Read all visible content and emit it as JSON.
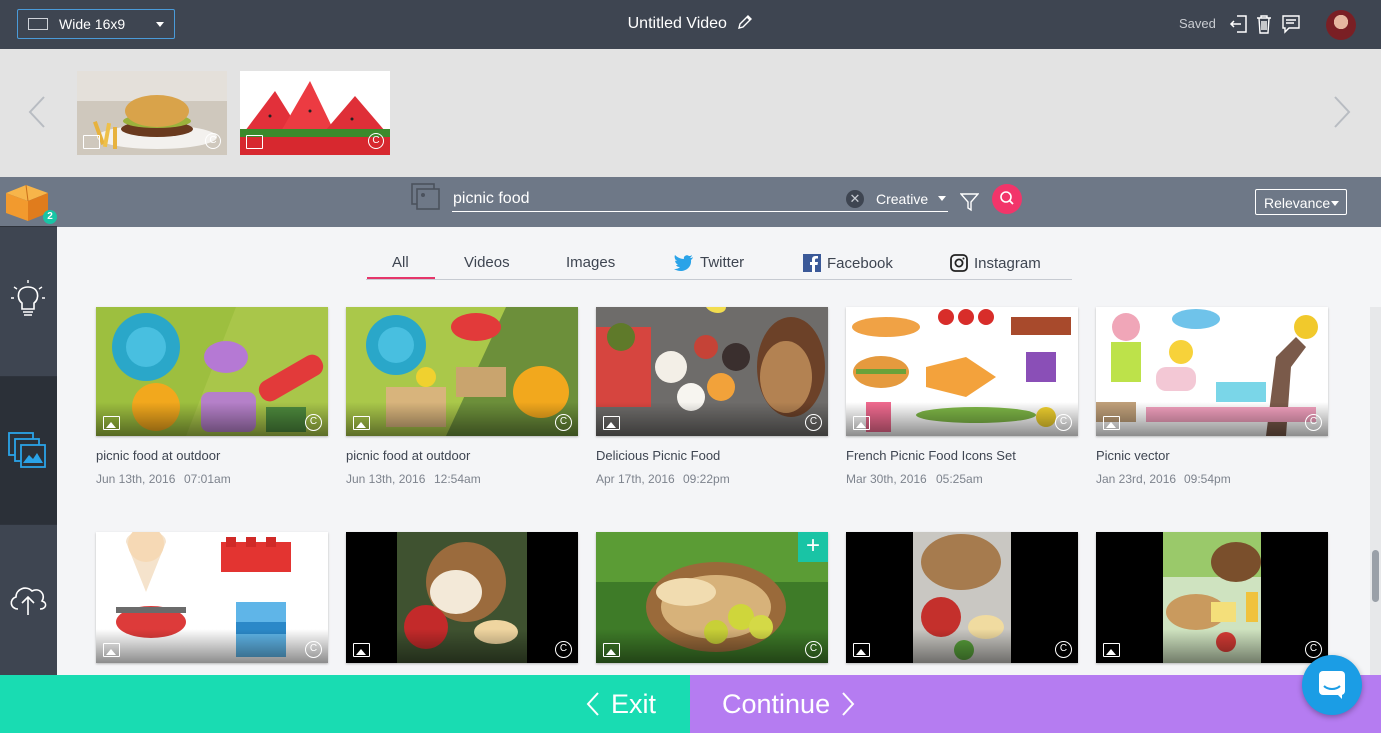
{
  "header": {
    "aspect_label": "Wide 16x9",
    "title": "Untitled Video",
    "saved_label": "Saved"
  },
  "search": {
    "query": "picnic food",
    "filter_label": "Creative",
    "sort_label": "Relevance"
  },
  "sidebar": {
    "badge_count": "2"
  },
  "tabs": [
    "All",
    "Videos",
    "Images",
    "Twitter",
    "Facebook",
    "Instagram"
  ],
  "results_row1": [
    {
      "title": "picnic food at outdoor",
      "date": "Jun 13th, 2016",
      "time": "07:01am"
    },
    {
      "title": "picnic food at outdoor",
      "date": "Jun 13th, 2016",
      "time": "12:54am"
    },
    {
      "title": "Delicious Picnic Food",
      "date": "Apr 17th, 2016",
      "time": "09:22pm"
    },
    {
      "title": "French Picnic Food Icons Set",
      "date": "Mar 30th, 2016",
      "time": "05:25am"
    },
    {
      "title": "Picnic vector",
      "date": "Jan 23rd, 2016",
      "time": "09:54pm"
    }
  ],
  "footer": {
    "exit_label": "Exit",
    "continue_label": "Continue"
  },
  "colors": {
    "accent_teal": "#19dcb2",
    "accent_purple": "#b57cf1",
    "search_pink": "#f2356a",
    "topbar": "#3e4551"
  },
  "icons": [
    "tv-icon",
    "pencil-icon",
    "exit-icon",
    "trash-icon",
    "comment-icon",
    "box-icon",
    "bulb-icon",
    "images-icon",
    "upload-cloud-icon",
    "filter-icon",
    "search-icon",
    "twitter-icon",
    "facebook-icon",
    "instagram-icon",
    "chat-icon"
  ]
}
